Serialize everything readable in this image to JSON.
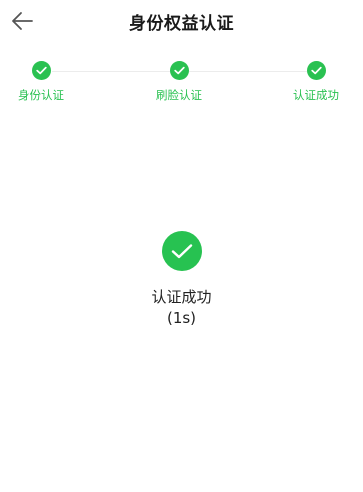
{
  "header": {
    "title": "身份权益认证",
    "back_icon": "arrow-left-icon"
  },
  "steps": [
    {
      "label": "身份认证",
      "status": "done",
      "icon": "check-icon"
    },
    {
      "label": "刷脸认证",
      "status": "done",
      "icon": "check-icon"
    },
    {
      "label": "认证成功",
      "status": "done",
      "icon": "check-icon"
    }
  ],
  "result": {
    "icon": "check-circle-icon",
    "message": "认证成功",
    "countdown": "(1s)"
  },
  "colors": {
    "accent": "#2ac151",
    "text": "#1a1a1a",
    "line": "#ececec"
  }
}
